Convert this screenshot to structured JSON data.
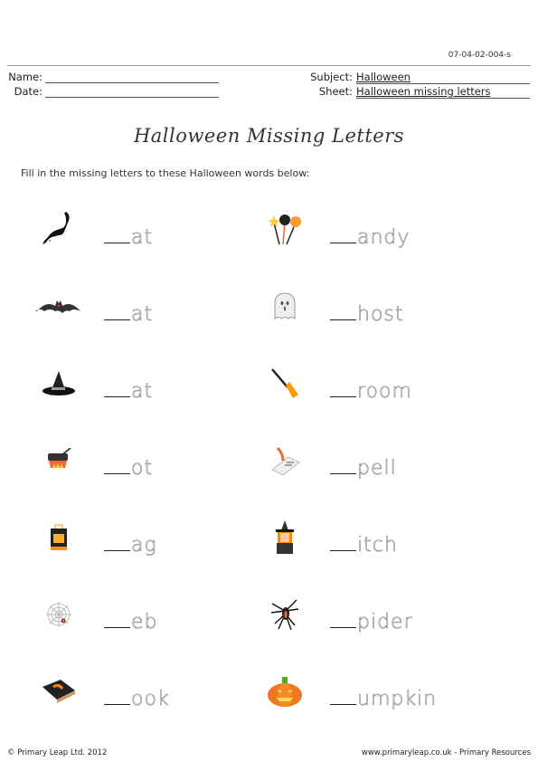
{
  "doc_code": "07-04-02-004-s",
  "header": {
    "name_label": "Name:",
    "date_label": "Date:",
    "subject_label": "Subject:",
    "subject_value": "Halloween",
    "sheet_label": "Sheet:",
    "sheet_value": "Halloween missing letters"
  },
  "title": "Halloween Missing Letters",
  "instructions": "Fill in the missing letters to these Halloween words below:",
  "left_items": [
    {
      "icon": "black-cat-icon",
      "word": "at"
    },
    {
      "icon": "bat-icon",
      "word": "at"
    },
    {
      "icon": "witch-hat-icon",
      "word": "at"
    },
    {
      "icon": "cauldron-pot-icon",
      "word": "ot"
    },
    {
      "icon": "treat-bag-icon",
      "word": "ag"
    },
    {
      "icon": "spider-web-icon",
      "word": "eb"
    },
    {
      "icon": "spell-book-icon",
      "word": "ook"
    }
  ],
  "right_items": [
    {
      "icon": "candy-lollipops-icon",
      "word": "andy"
    },
    {
      "icon": "ghost-icon",
      "word": "host"
    },
    {
      "icon": "broom-icon",
      "word": "room"
    },
    {
      "icon": "spell-scroll-quill-icon",
      "word": "pell"
    },
    {
      "icon": "witch-icon",
      "word": "itch"
    },
    {
      "icon": "spider-icon",
      "word": "pider"
    },
    {
      "icon": "pumpkin-icon",
      "word": "umpkin"
    }
  ],
  "footer": {
    "copyright": "© Primary Leap Ltd. 2012",
    "website": "www.primaryleap.co.uk  -  Primary Resources"
  }
}
